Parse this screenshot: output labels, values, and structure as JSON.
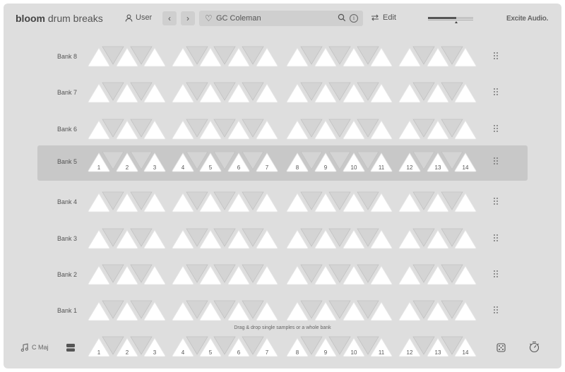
{
  "app": {
    "brand_bold": "bloom",
    "brand_rest": "drum breaks",
    "logo": "Excite Audio."
  },
  "header": {
    "user_label": "User",
    "prev_icon": "chevron-left-icon",
    "next_icon": "chevron-right-icon",
    "search_value": "GC Coleman",
    "edit_label": "Edit"
  },
  "banks": [
    {
      "label": "Bank 8",
      "selected": false
    },
    {
      "label": "Bank 7",
      "selected": false
    },
    {
      "label": "Bank 6",
      "selected": false
    },
    {
      "label": "Bank 5",
      "selected": true
    },
    {
      "label": "Bank 4",
      "selected": false
    },
    {
      "label": "Bank 3",
      "selected": false
    },
    {
      "label": "Bank 2",
      "selected": false
    },
    {
      "label": "Bank 1",
      "selected": false
    }
  ],
  "pad_numbers": [
    "1",
    "2",
    "3",
    "4",
    "5",
    "6",
    "7",
    "8",
    "9",
    "10",
    "11",
    "12",
    "13",
    "14"
  ],
  "hint": "Drag & drop single samples or a whole bank",
  "footer": {
    "key_label": "C Maj"
  },
  "colors": {
    "bg": "#dedede",
    "selected_row": "#c8c8c8",
    "pad_up": "#ffffff",
    "pad_down": "#d4d4d4"
  }
}
